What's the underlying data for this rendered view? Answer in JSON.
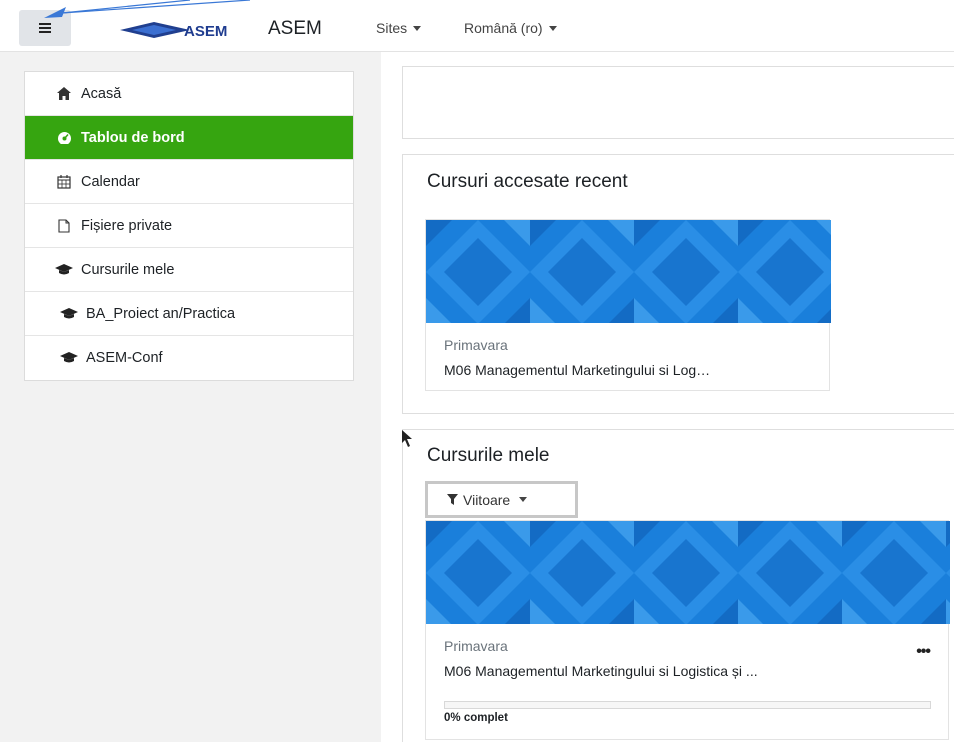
{
  "navbar": {
    "site_name": "ASEM",
    "logo_text": "ASEM",
    "sites_menu": "Sites",
    "language_menu": "Română (ro)"
  },
  "drawer": {
    "items": [
      {
        "label": "Acasă",
        "icon": "home-icon"
      },
      {
        "label": "Tablou de bord",
        "icon": "dashboard-icon",
        "active": true
      },
      {
        "label": "Calendar",
        "icon": "calendar-icon"
      },
      {
        "label": "Fișiere private",
        "icon": "file-icon"
      },
      {
        "label": "Cursurile mele",
        "icon": "graduation-cap-icon"
      },
      {
        "label": "BA_Proiect an/Practica",
        "icon": "graduation-cap-icon"
      },
      {
        "label": "ASEM-Conf",
        "icon": "graduation-cap-icon"
      }
    ]
  },
  "recent": {
    "title": "Cursuri accesate recent",
    "course": {
      "category": "Primavara",
      "name": "M06 Managementul Marketingului si Log…"
    }
  },
  "mycourses": {
    "title": "Cursurile mele",
    "filter_label": "Viitoare",
    "course": {
      "category": "Primavara",
      "name": "M06 Managementul Marketingului si Logistica și ...",
      "menu": "•••",
      "progress_percent": 0,
      "progress_label": "0% complet"
    }
  },
  "colors": {
    "active_green": "#36a510",
    "banner_blue": "#1a7fdb"
  }
}
